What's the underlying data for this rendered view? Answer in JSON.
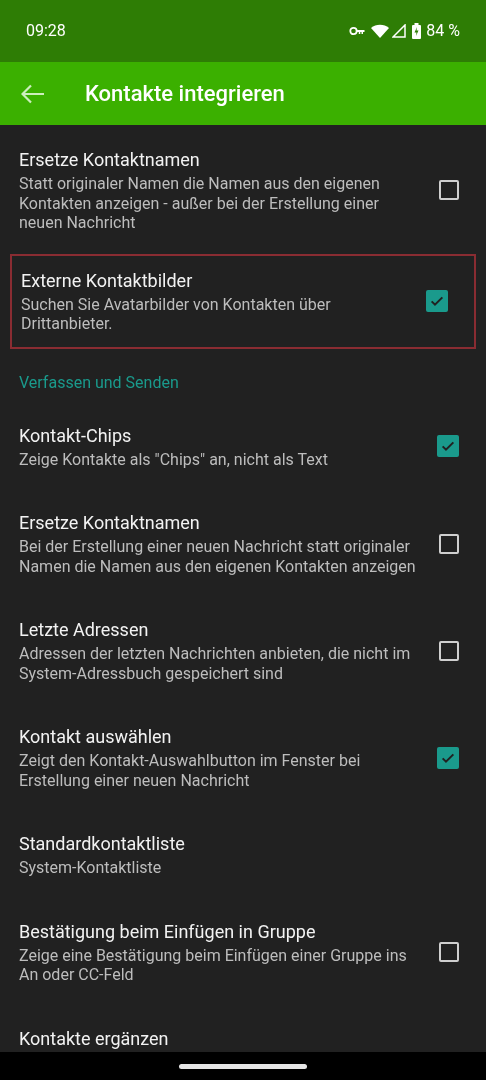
{
  "status_bar": {
    "time": "09:28",
    "battery": "84 %"
  },
  "app_bar": {
    "title": "Kontakte integrieren"
  },
  "items": [
    {
      "kind": "checkbox",
      "title": "Ersetze Kontaktnamen",
      "summary": "Statt originaler Namen die Namen aus den eigenen Kontakten anzeigen - außer bei der Erstellung einer neuen Nachricht",
      "checked": false,
      "highlighted": false
    },
    {
      "kind": "checkbox",
      "title": "Externe Kontaktbilder",
      "summary": "Suchen Sie Avatarbilder von Kontakten über Drittanbieter.",
      "checked": true,
      "highlighted": true
    },
    {
      "kind": "header",
      "title": "Verfassen und Senden"
    },
    {
      "kind": "checkbox",
      "title": "Kontakt-Chips",
      "summary": "Zeige Kontakte als \"Chips\" an, nicht als Text",
      "checked": true,
      "highlighted": false
    },
    {
      "kind": "checkbox",
      "title": "Ersetze Kontaktnamen",
      "summary": "Bei der Erstellung einer neuen Nachricht statt originaler Namen die Namen aus den eigenen Kontakten anzeigen",
      "checked": false,
      "highlighted": false
    },
    {
      "kind": "checkbox",
      "title": "Letzte Adressen",
      "summary": "Adressen der letzten Nachrichten anbieten, die nicht im System-Adressbuch gespeichert sind",
      "checked": false,
      "highlighted": false
    },
    {
      "kind": "checkbox",
      "title": "Kontakt auswählen",
      "summary": "Zeigt den Kontakt-Auswahlbutton im Fenster bei Erstellung einer neuen Nachricht",
      "checked": true,
      "highlighted": false
    },
    {
      "kind": "plain",
      "title": "Standardkontaktliste",
      "summary": "System-Kontaktliste",
      "highlighted": false
    },
    {
      "kind": "checkbox",
      "title": "Bestätigung beim Einfügen in Gruppe",
      "summary": "Zeige eine Bestätigung beim Einfügen einer Gruppe ins An oder CC-Feld",
      "checked": false,
      "highlighted": false
    },
    {
      "kind": "plain",
      "title": "Kontakte ergänzen",
      "highlighted": false
    }
  ]
}
